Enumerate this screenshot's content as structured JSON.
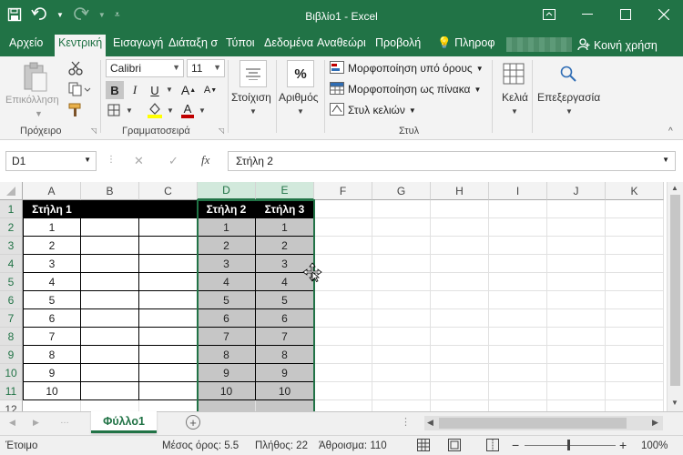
{
  "window": {
    "title": "Βιβλίο1 - Excel"
  },
  "ribbon_tabs": [
    "Αρχείο",
    "Κεντρική",
    "Εισαγωγή",
    "Διάταξη σ",
    "Τύποι",
    "Δεδομένα",
    "Αναθεώρι",
    "Προβολή",
    "Πληροφ"
  ],
  "share_label": "Κοινή χρήση",
  "clipboard": {
    "paste": "Επικόλληση",
    "group": "Πρόχειρο"
  },
  "font": {
    "name": "Calibri",
    "size": "11",
    "bold": "B",
    "italic": "I",
    "underline": "U",
    "grow": "A",
    "shrink": "A",
    "color_letter": "A",
    "group": "Γραμματοσειρά"
  },
  "alignment": {
    "label": "Στοίχιση"
  },
  "number": {
    "label": "Αριθμός",
    "symbol": "%"
  },
  "styles": {
    "conditional": "Μορφοποίηση υπό όρους",
    "as_table": "Μορφοποίηση ως πίνακα",
    "cell_styles": "Στυλ κελιών",
    "group": "Στυλ"
  },
  "cells": {
    "label": "Κελιά"
  },
  "editing": {
    "label": "Επεξεργασία"
  },
  "formula_bar": {
    "name_box": "D1",
    "fx": "fx",
    "value": "Στήλη 2"
  },
  "columns": [
    "A",
    "B",
    "C",
    "D",
    "E",
    "F",
    "G",
    "H",
    "I",
    "J",
    "K"
  ],
  "rows": [
    "1",
    "2",
    "3",
    "4",
    "5",
    "6",
    "7",
    "8",
    "9",
    "10",
    "11",
    "12"
  ],
  "table": {
    "headers": {
      "A": "Στήλη 1",
      "D": "Στήλη 2",
      "E": "Στήλη 3"
    },
    "values": [
      "1",
      "2",
      "3",
      "4",
      "5",
      "6",
      "7",
      "8",
      "9",
      "10"
    ]
  },
  "sheet": {
    "name": "Φύλλο1"
  },
  "status": {
    "ready": "Έτοιμο",
    "average": "Μέσος όρος: 5.5",
    "count": "Πλήθος: 22",
    "sum": "Άθροισμα: 110",
    "zoom": "100%"
  },
  "colors": {
    "accent": "#217346",
    "header_fill": "#000000",
    "selection_fill": "#c6c6c6"
  }
}
